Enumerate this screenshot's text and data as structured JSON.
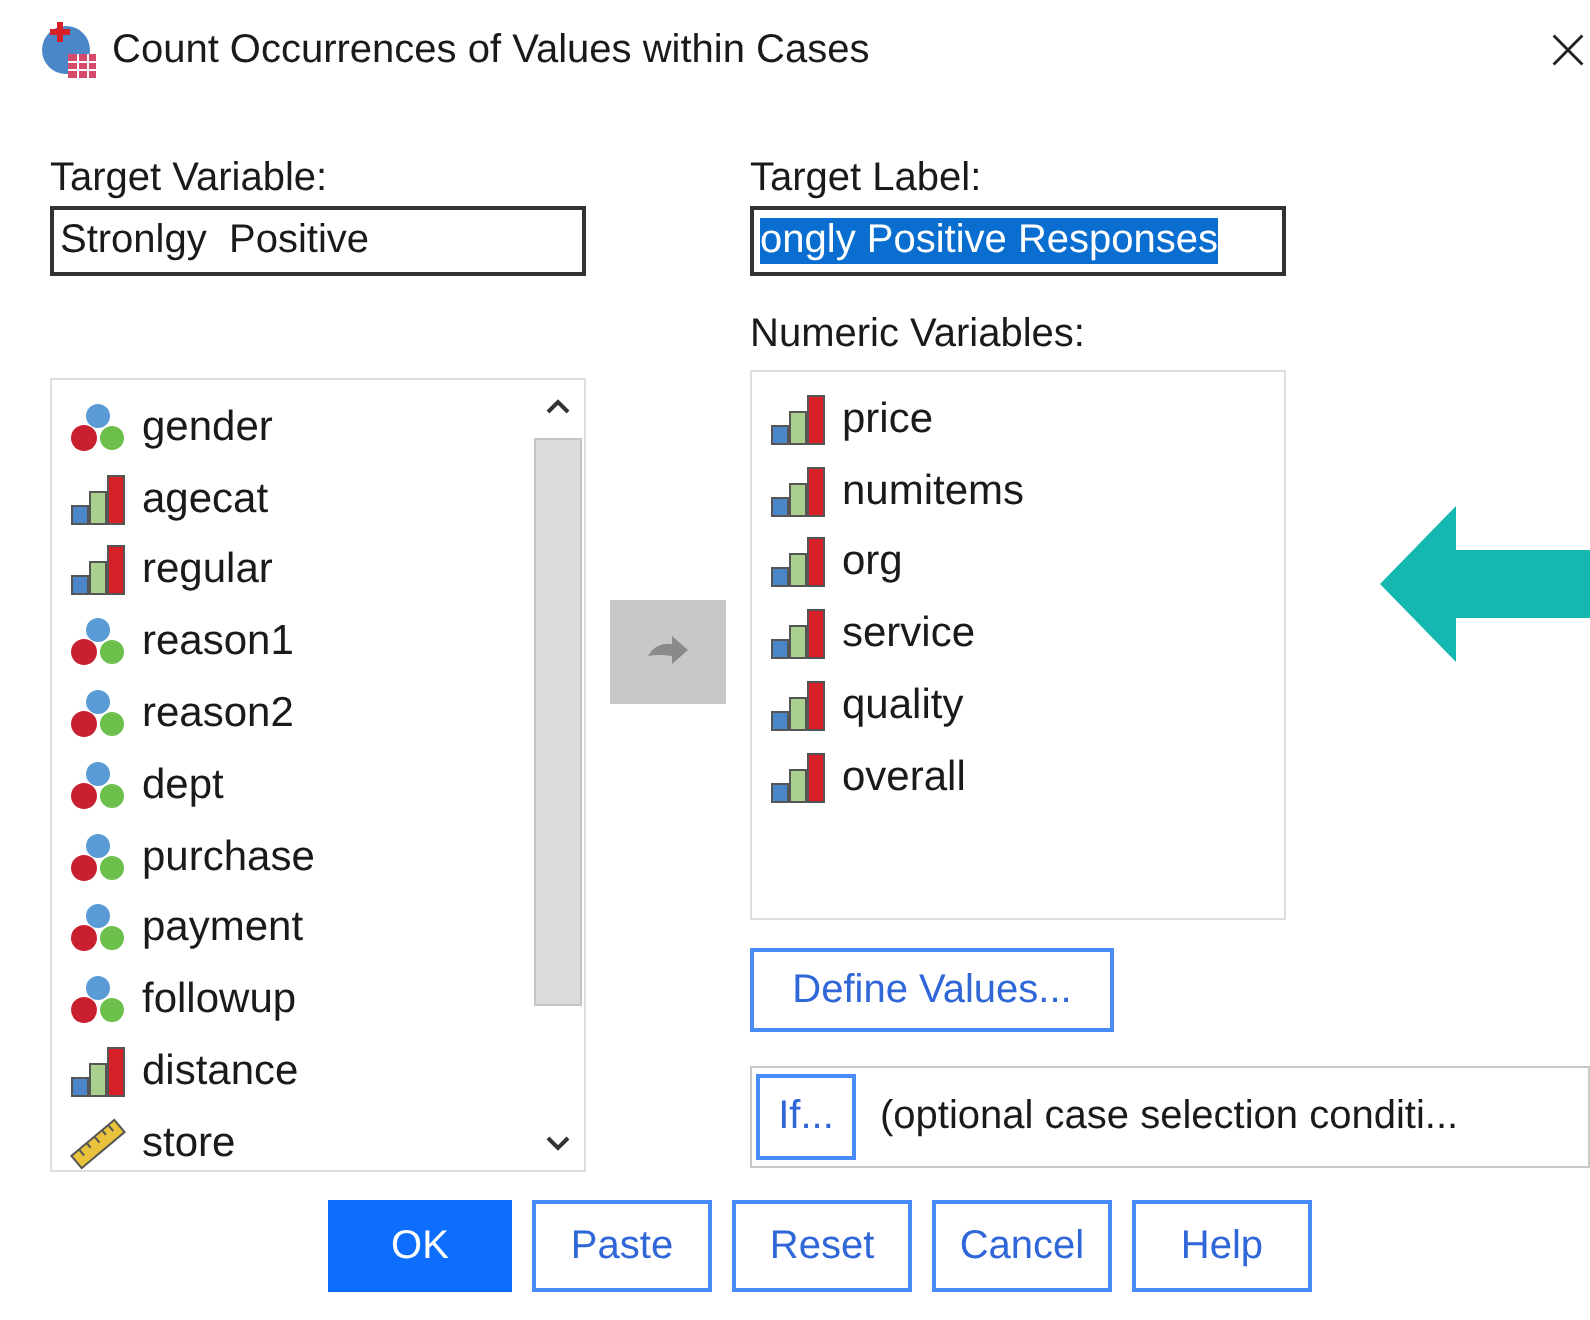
{
  "window": {
    "title": "Count Occurrences of Values within Cases"
  },
  "target_variable": {
    "label": "Target Variable:",
    "value": "Stronlgy  Positive"
  },
  "target_label": {
    "label": "Target Label:",
    "value": "ongly Positive Responses",
    "text_selected": true
  },
  "source_list": {
    "items": [
      {
        "name": "gender",
        "kind": "nominal"
      },
      {
        "name": "agecat",
        "kind": "ordinal"
      },
      {
        "name": "regular",
        "kind": "ordinal"
      },
      {
        "name": "reason1",
        "kind": "nominal"
      },
      {
        "name": "reason2",
        "kind": "nominal"
      },
      {
        "name": "dept",
        "kind": "nominal"
      },
      {
        "name": "purchase",
        "kind": "nominal"
      },
      {
        "name": "payment",
        "kind": "nominal"
      },
      {
        "name": "followup",
        "kind": "nominal"
      },
      {
        "name": "distance",
        "kind": "ordinal"
      },
      {
        "name": "store",
        "kind": "scale"
      }
    ]
  },
  "move_button": {
    "disabled": true
  },
  "numeric_variables": {
    "label": "Numeric Variables:",
    "items": [
      {
        "name": "price",
        "kind": "ordinal"
      },
      {
        "name": "numitems",
        "kind": "ordinal"
      },
      {
        "name": "org",
        "kind": "ordinal"
      },
      {
        "name": "service",
        "kind": "ordinal"
      },
      {
        "name": "quality",
        "kind": "ordinal"
      },
      {
        "name": "overall",
        "kind": "ordinal"
      }
    ]
  },
  "define_values_button": "Define Values...",
  "if_button": "If...",
  "if_condition": "(optional case selection conditi...",
  "buttons": [
    {
      "label": "OK",
      "default": true
    },
    {
      "label": "Paste",
      "default": false
    },
    {
      "label": "Reset",
      "default": false
    },
    {
      "label": "Cancel",
      "default": false
    },
    {
      "label": "Help",
      "default": false
    }
  ]
}
